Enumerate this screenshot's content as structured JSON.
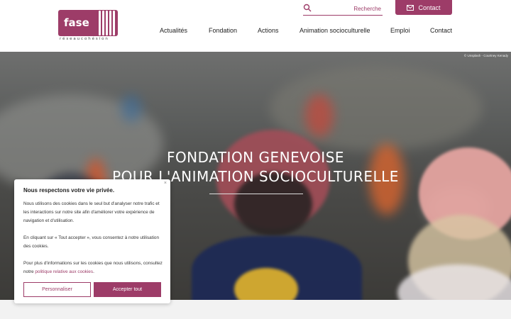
{
  "header": {
    "logo": {
      "name": "fase",
      "tagline": "réseaucohésion"
    },
    "search": {
      "placeholder": "Recherche"
    },
    "contact_button": "Contact",
    "nav": [
      "Actualités",
      "Fondation",
      "Actions",
      "Animation socioculturelle",
      "Emploi",
      "Contact"
    ]
  },
  "hero": {
    "credit": "© Unsplash - Courtney Kenady",
    "title_line1": "FONDATION GENEVOISE",
    "title_line2": "POUR L'ANIMATION SOCIOCULTURELLE"
  },
  "cookie": {
    "close": "×",
    "title": "Nous respectons votre vie privée.",
    "p1": "Nous utilisons des cookies dans le seul but d'analyser notre trafic et les interactions sur notre site afin d'améliorer votre expérience de navigation et d'utilisation.",
    "p2": "En cliquant sur « Tout accepter », vous consentez à notre utilisation des cookies.",
    "p3_prefix": "Pour plus d'informations sur les cookies que nous utilisons, consultez notre ",
    "p3_link": "politique relative aux cookies",
    "p3_suffix": ".",
    "customize": "Personnaliser",
    "accept_all": "Accepter tout"
  },
  "colors": {
    "brand": "#9d3c68"
  },
  "icons": {
    "search": "search-icon",
    "envelope": "envelope-icon",
    "close": "close-icon"
  }
}
